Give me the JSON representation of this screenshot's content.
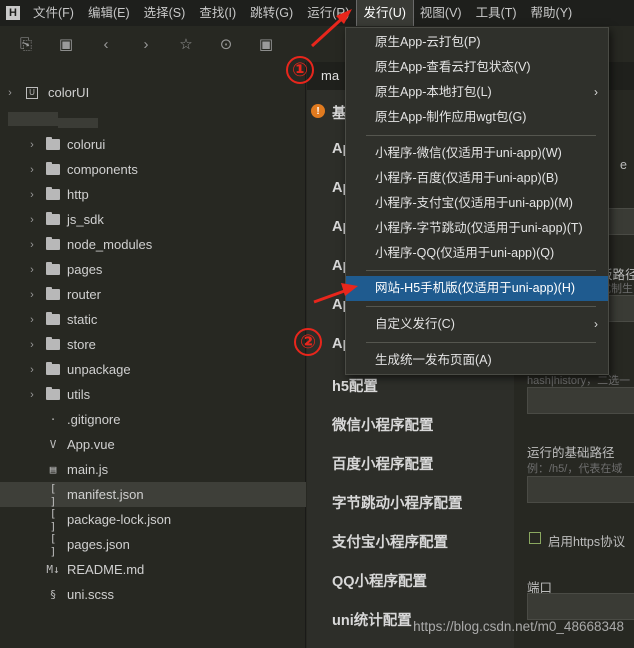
{
  "menubar": {
    "logo": "H",
    "items": [
      "文件(F)",
      "编辑(E)",
      "选择(S)",
      "查找(I)",
      "跳转(G)",
      "运行(R)",
      "发行(U)",
      "视图(V)",
      "工具(T)",
      "帮助(Y)"
    ]
  },
  "sidebar": {
    "project": "colorUI",
    "items": [
      {
        "label": "colorui",
        "type": "folder"
      },
      {
        "label": "components",
        "type": "folder"
      },
      {
        "label": "http",
        "type": "folder"
      },
      {
        "label": "js_sdk",
        "type": "folder"
      },
      {
        "label": "node_modules",
        "type": "folder"
      },
      {
        "label": "pages",
        "type": "folder"
      },
      {
        "label": "router",
        "type": "folder"
      },
      {
        "label": "static",
        "type": "folder"
      },
      {
        "label": "store",
        "type": "folder"
      },
      {
        "label": "unpackage",
        "type": "folder"
      },
      {
        "label": "utils",
        "type": "folder"
      },
      {
        "label": ".gitignore",
        "type": "file",
        "icon": "·"
      },
      {
        "label": "App.vue",
        "type": "file",
        "icon": "V"
      },
      {
        "label": "main.js",
        "type": "file",
        "icon": "▤"
      },
      {
        "label": "manifest.json",
        "type": "file",
        "icon": "[ ]"
      },
      {
        "label": "package-lock.json",
        "type": "file",
        "icon": "[ ]"
      },
      {
        "label": "pages.json",
        "type": "file",
        "icon": "[ ]"
      },
      {
        "label": "README.md",
        "type": "file",
        "icon": "M↓"
      },
      {
        "label": "uni.scss",
        "type": "file",
        "icon": "§"
      }
    ]
  },
  "editor": {
    "tab": "ma",
    "config_items": [
      "基",
      "Ap",
      "Ap",
      "Ap",
      "Ap",
      "Ap",
      "Ap",
      "h5配置",
      "微信小程序配置",
      "百度小程序配置",
      "字节跳动小程序配置",
      "支付宝小程序配置",
      "QQ小程序配置",
      "uni统计配置"
    ],
    "form": {
      "hint_top": "e",
      "route_label": "板路径",
      "route_hint": "式制生",
      "history_hint": "hash|history，二选一",
      "base_label": "运行的基础路径",
      "base_hint": "例：/h5/，代表在域",
      "https_label": "启用https协议",
      "port_label": "端口"
    }
  },
  "dropdown": {
    "items": [
      {
        "label": "原生App-云打包(P)"
      },
      {
        "label": "原生App-查看云打包状态(V)"
      },
      {
        "label": "原生App-本地打包(L)",
        "submenu": true
      },
      {
        "label": "原生App-制作应用wgt包(G)"
      },
      {
        "label": "小程序-微信(仅适用于uni-app)(W)"
      },
      {
        "label": "小程序-百度(仅适用于uni-app)(B)"
      },
      {
        "label": "小程序-支付宝(仅适用于uni-app)(M)"
      },
      {
        "label": "小程序-字节跳动(仅适用于uni-app)(T)"
      },
      {
        "label": "小程序-QQ(仅适用于uni-app)(Q)"
      },
      {
        "label": "网站-H5手机版(仅适用于uni-app)(H)"
      },
      {
        "label": "自定义发行(C)",
        "submenu": true
      },
      {
        "label": "生成统一发布页面(A)"
      }
    ]
  },
  "annotations": {
    "step1": "①",
    "step2": "②",
    "color": "#e8261c"
  },
  "watermark": "https://blog.csdn.net/m0_48668348"
}
